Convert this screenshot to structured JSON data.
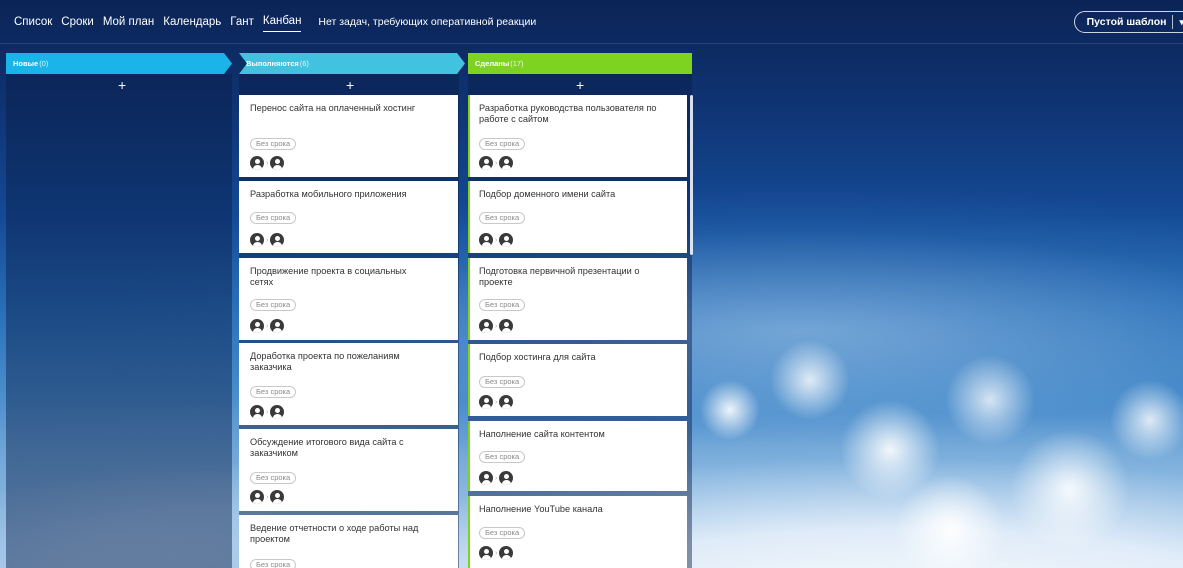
{
  "nav": {
    "items": [
      "Список",
      "Сроки",
      "Мой план",
      "Календарь",
      "Гант",
      "Канбан"
    ],
    "active": "Канбан",
    "notice": "Нет задач, требующих оперативной реакции"
  },
  "template_button": {
    "label": "Пустой шаблон",
    "icon": "chevron-down-icon"
  },
  "columns": {
    "new": {
      "label": "Новые",
      "count": "(0)",
      "color": "#1ab4e9"
    },
    "progress": {
      "label": "Выполняются",
      "count": "(6)",
      "color": "#41c2de"
    },
    "done": {
      "label": "Сделаны",
      "count": "(17)",
      "color": "#7ed321"
    }
  },
  "add_symbol": "+",
  "arrow_symbol": "›",
  "progress_cards": [
    {
      "title": "Перенос сайта на оплаченный хостинг",
      "deadline": "Без срока"
    },
    {
      "title": "Разработка мобильного приложения",
      "deadline": "Без срока"
    },
    {
      "title": "Продвижение проекта в социальных сетях",
      "deadline": "Без срока"
    },
    {
      "title": "Доработка проекта по пожеланиям заказчика",
      "deadline": "Без срока"
    },
    {
      "title": "Обсуждение итогового вида сайта с заказчиком",
      "deadline": "Без срока"
    },
    {
      "title": "Ведение отчетности о ходе работы над проектом",
      "deadline": "Без срока"
    }
  ],
  "done_cards": [
    {
      "title": "Разработка руководства пользователя по работе с сайтом",
      "deadline": "Без срока"
    },
    {
      "title": "Подбор доменного имени сайта",
      "deadline": "Без срока"
    },
    {
      "title": "Подготовка первичной презентации о проекте",
      "deadline": "Без срока"
    },
    {
      "title": "Подбор хостинга для сайта",
      "deadline": "Без срока"
    },
    {
      "title": "Наполнение сайта контентом",
      "deadline": "Без срока"
    },
    {
      "title": "Наполнение YouTube канала",
      "deadline": "Без срока"
    }
  ]
}
